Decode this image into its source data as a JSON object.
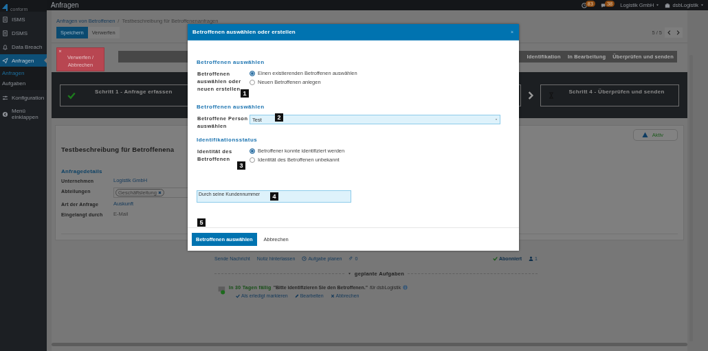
{
  "app": {
    "logo_text": "conform",
    "page_title": "Anfragen"
  },
  "sidebar": {
    "items": [
      {
        "label": "ISMS",
        "selected": false
      },
      {
        "label": "DSMS",
        "selected": false
      },
      {
        "label": "Data Breach",
        "selected": false
      },
      {
        "label": "Anfragen",
        "selected": true,
        "expanded": true,
        "children": [
          {
            "label": "Anfragen",
            "selected": true
          },
          {
            "label": "Aufgaben",
            "selected": false
          }
        ]
      },
      {
        "label": "Konfiguration",
        "selected": false
      },
      {
        "label": "Menü einklappen",
        "selected": false
      }
    ]
  },
  "topbar": {
    "notifications": [
      {
        "count": "83"
      },
      {
        "count": "38"
      }
    ],
    "company": "Logistik GmbH",
    "user": "dsbLogistik"
  },
  "toolbar": {
    "breadcrumb": [
      "Anfragen von Betroffenen",
      "Testbeschreibung für Betroffenenanfragen"
    ],
    "breadcrumb_separator": "/",
    "buttons": [
      {
        "label": "Speichern",
        "kind": "primary"
      },
      {
        "label": "Verwerfen",
        "kind": "default"
      }
    ],
    "pager": "5 / 5"
  },
  "discard_button": "Verwerfen / Abbrechen",
  "steps_ribbon": [
    "Identifikation",
    "In Bearbeitung",
    "Überprüfen und senden"
  ],
  "step_boxes": [
    {
      "label": "Schritt 1 - Anfrage erfassen",
      "kind": "done"
    },
    {
      "label": "Schritt 4 - Überprüfen und senden",
      "kind": "pending"
    }
  ],
  "request": {
    "title": "Testbeschreibung für Betroffenena",
    "status": "Aktiv",
    "details_heading": "Anfragedetails",
    "details": [
      {
        "label": "Unternehmen",
        "kind": "link",
        "value": "Logistik GmbH"
      },
      {
        "label": "Abteilungen",
        "kind": "tags",
        "tags": [
          "Geschäftsleitung"
        ]
      },
      {
        "label": "Art der Anfrage",
        "kind": "link",
        "value": "Auskunft"
      },
      {
        "label": "Eingelangt durch",
        "kind": "text",
        "value": "E-Mail"
      }
    ]
  },
  "actions": {
    "send_message": "Sende Nachricht",
    "leave_note": "Notiz hinterlassen",
    "schedule_task": "Aufgabe planen",
    "attachments": "0",
    "subscribed": "Abonniert",
    "subscribers": "1"
  },
  "tasks": {
    "heading": "geplante Aufgaben",
    "expanded": true,
    "items": [
      {
        "due": "In 30 Tagen fällig",
        "text": "\"Bitte identifizieren Sie den Betroffenen.\"",
        "assignee": "*für* dsbLogistik",
        "actions": [
          "Als erledigt markieren",
          "Bearbeiten",
          "Abbrechen"
        ]
      }
    ]
  },
  "dialog": {
    "title": "Betroffenen auswählen oder erstellen",
    "close": "×",
    "sections": [
      {
        "kind": "radio",
        "heading": "Betroffenen auswählen",
        "label": "Betroffenen auswählen oder neuen erstellen",
        "options": [
          {
            "label": "Einen existierenden Betroffenen auswählen",
            "selected": true
          },
          {
            "label": "Neuen Betroffenen anlegen",
            "selected": false
          }
        ]
      },
      {
        "kind": "select",
        "heading": "Betroffenen auswählen",
        "label": "Betroffene Person auswählen",
        "value": "Test"
      },
      {
        "kind": "radio",
        "heading": "Identifikationsstatus",
        "label": "Identität des Betroffenen",
        "options": [
          {
            "label": "Betroffener konnte identifiziert werden",
            "selected": true
          },
          {
            "label": "Identität des Betroffenen unbekannt",
            "selected": false
          }
        ]
      },
      {
        "kind": "textarea",
        "value": "Durch seine Kundennummer"
      }
    ],
    "buttons": [
      {
        "label": "Betroffenen auswählen",
        "kind": "primary"
      },
      {
        "label": "Abbrechen",
        "kind": "link"
      }
    ]
  },
  "callouts": [
    "1",
    "2",
    "3",
    "4",
    "5"
  ]
}
